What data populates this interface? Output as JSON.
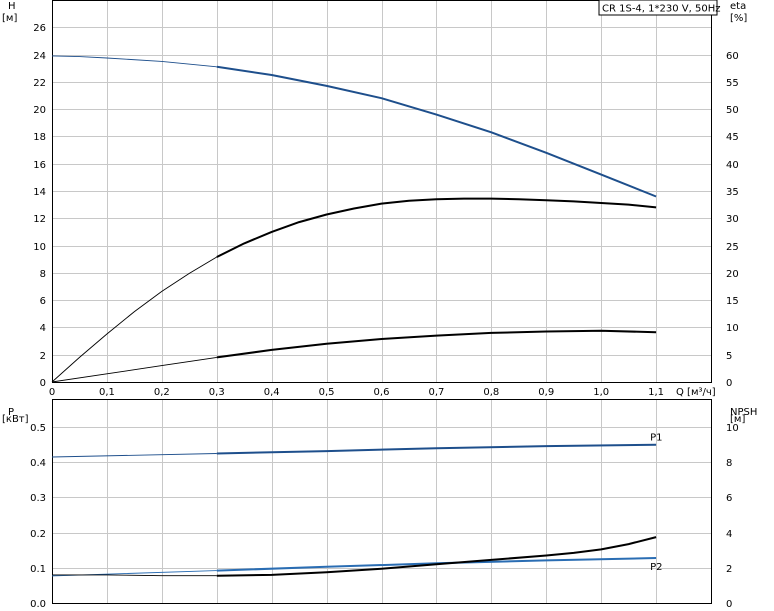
{
  "legend_box": "CR 1S-4, 1*230 V, 50Hz",
  "colors": {
    "blue": "#1e4f8c",
    "light_blue": "#2a6db3",
    "black": "#000000",
    "grid": "#c8c8c8"
  },
  "chart_data": [
    {
      "type": "line",
      "panel": "top",
      "x_label": "Q [м³/ч]",
      "y_left_label": [
        "H",
        "[м]"
      ],
      "y_right_label": [
        "eta",
        "[%]"
      ],
      "xlim": [
        0,
        1.2
      ],
      "ylim_left": [
        0,
        28
      ],
      "ylim_right": [
        0,
        70
      ],
      "x_ticks": [
        "0",
        "0,1",
        "0,2",
        "0,3",
        "0,4",
        "0,5",
        "0,6",
        "0,7",
        "0,8",
        "0,9",
        "1,0",
        "1,1"
      ],
      "y_left_ticks": [
        "0",
        "2",
        "4",
        "6",
        "8",
        "10",
        "12",
        "14",
        "16",
        "18",
        "20",
        "22",
        "24",
        "26"
      ],
      "y_right_ticks": [
        "0",
        "5",
        "10",
        "15",
        "20",
        "25",
        "30",
        "35",
        "40",
        "45",
        "50",
        "55",
        "60"
      ],
      "grid": true,
      "series": [
        {
          "color": "blue",
          "axis": "left",
          "thin_until": 0.3,
          "points": [
            [
              0,
              23.9
            ],
            [
              0.05,
              23.85
            ],
            [
              0.1,
              23.75
            ],
            [
              0.2,
              23.5
            ],
            [
              0.3,
              23.1
            ],
            [
              0.4,
              22.5
            ],
            [
              0.5,
              21.7
            ],
            [
              0.6,
              20.8
            ],
            [
              0.7,
              19.6
            ],
            [
              0.8,
              18.3
            ],
            [
              0.9,
              16.8
            ],
            [
              1.0,
              15.2
            ],
            [
              1.1,
              13.6
            ]
          ]
        },
        {
          "color": "black",
          "axis": "right",
          "thin_until": 0.3,
          "points": [
            [
              0,
              0
            ],
            [
              0.05,
              4.5
            ],
            [
              0.1,
              8.8
            ],
            [
              0.15,
              12.9
            ],
            [
              0.2,
              16.6
            ],
            [
              0.25,
              19.9
            ],
            [
              0.3,
              22.9
            ],
            [
              0.35,
              25.4
            ],
            [
              0.4,
              27.5
            ],
            [
              0.45,
              29.3
            ],
            [
              0.5,
              30.7
            ],
            [
              0.55,
              31.8
            ],
            [
              0.6,
              32.7
            ],
            [
              0.65,
              33.2
            ],
            [
              0.7,
              33.5
            ],
            [
              0.75,
              33.6
            ],
            [
              0.8,
              33.6
            ],
            [
              0.85,
              33.5
            ],
            [
              0.9,
              33.3
            ],
            [
              0.95,
              33.1
            ],
            [
              1.0,
              32.8
            ],
            [
              1.05,
              32.5
            ],
            [
              1.1,
              32.0
            ]
          ]
        },
        {
          "color": "black",
          "axis": "left",
          "thin_until": 0.3,
          "points": [
            [
              0,
              0
            ],
            [
              0.1,
              0.6
            ],
            [
              0.2,
              1.2
            ],
            [
              0.3,
              1.8
            ],
            [
              0.4,
              2.35
            ],
            [
              0.5,
              2.8
            ],
            [
              0.6,
              3.15
            ],
            [
              0.7,
              3.4
            ],
            [
              0.8,
              3.6
            ],
            [
              0.9,
              3.7
            ],
            [
              1.0,
              3.75
            ],
            [
              1.1,
              3.65
            ]
          ]
        }
      ]
    },
    {
      "type": "line",
      "panel": "bottom",
      "y_left_label": [
        "P",
        "[кВт]"
      ],
      "y_right_label": [
        "NPSH",
        "[м]"
      ],
      "xlim": [
        0,
        1.2
      ],
      "ylim_left": [
        0,
        0.58
      ],
      "ylim_right": [
        0,
        11.6
      ],
      "y_left_ticks": [
        "0.0",
        "0.1",
        "0.2",
        "0.3",
        "0.4",
        "0.5"
      ],
      "y_right_ticks": [
        "0",
        "2",
        "4",
        "6",
        "8",
        "10"
      ],
      "grid": true,
      "series": [
        {
          "name": "P1",
          "color": "blue",
          "axis": "left",
          "thin_until": 0.3,
          "points": [
            [
              0,
              0.415
            ],
            [
              0.3,
              0.425
            ],
            [
              0.5,
              0.432
            ],
            [
              0.7,
              0.44
            ],
            [
              0.9,
              0.446
            ],
            [
              1.1,
              0.45
            ]
          ]
        },
        {
          "name": "P2",
          "color": "light_blue",
          "axis": "left",
          "thin_until": 0.3,
          "points": [
            [
              0,
              0.077
            ],
            [
              0.3,
              0.092
            ],
            [
              0.5,
              0.103
            ],
            [
              0.7,
              0.113
            ],
            [
              0.9,
              0.121
            ],
            [
              1.1,
              0.128
            ]
          ]
        },
        {
          "color": "black",
          "axis": "right",
          "thin_until": 0.3,
          "points": [
            [
              0,
              1.6
            ],
            [
              0.1,
              1.6
            ],
            [
              0.2,
              1.55
            ],
            [
              0.3,
              1.55
            ],
            [
              0.4,
              1.6
            ],
            [
              0.5,
              1.75
            ],
            [
              0.6,
              1.95
            ],
            [
              0.7,
              2.2
            ],
            [
              0.8,
              2.45
            ],
            [
              0.9,
              2.7
            ],
            [
              0.95,
              2.85
            ],
            [
              1.0,
              3.05
            ],
            [
              1.05,
              3.35
            ],
            [
              1.1,
              3.75
            ]
          ]
        }
      ]
    }
  ]
}
